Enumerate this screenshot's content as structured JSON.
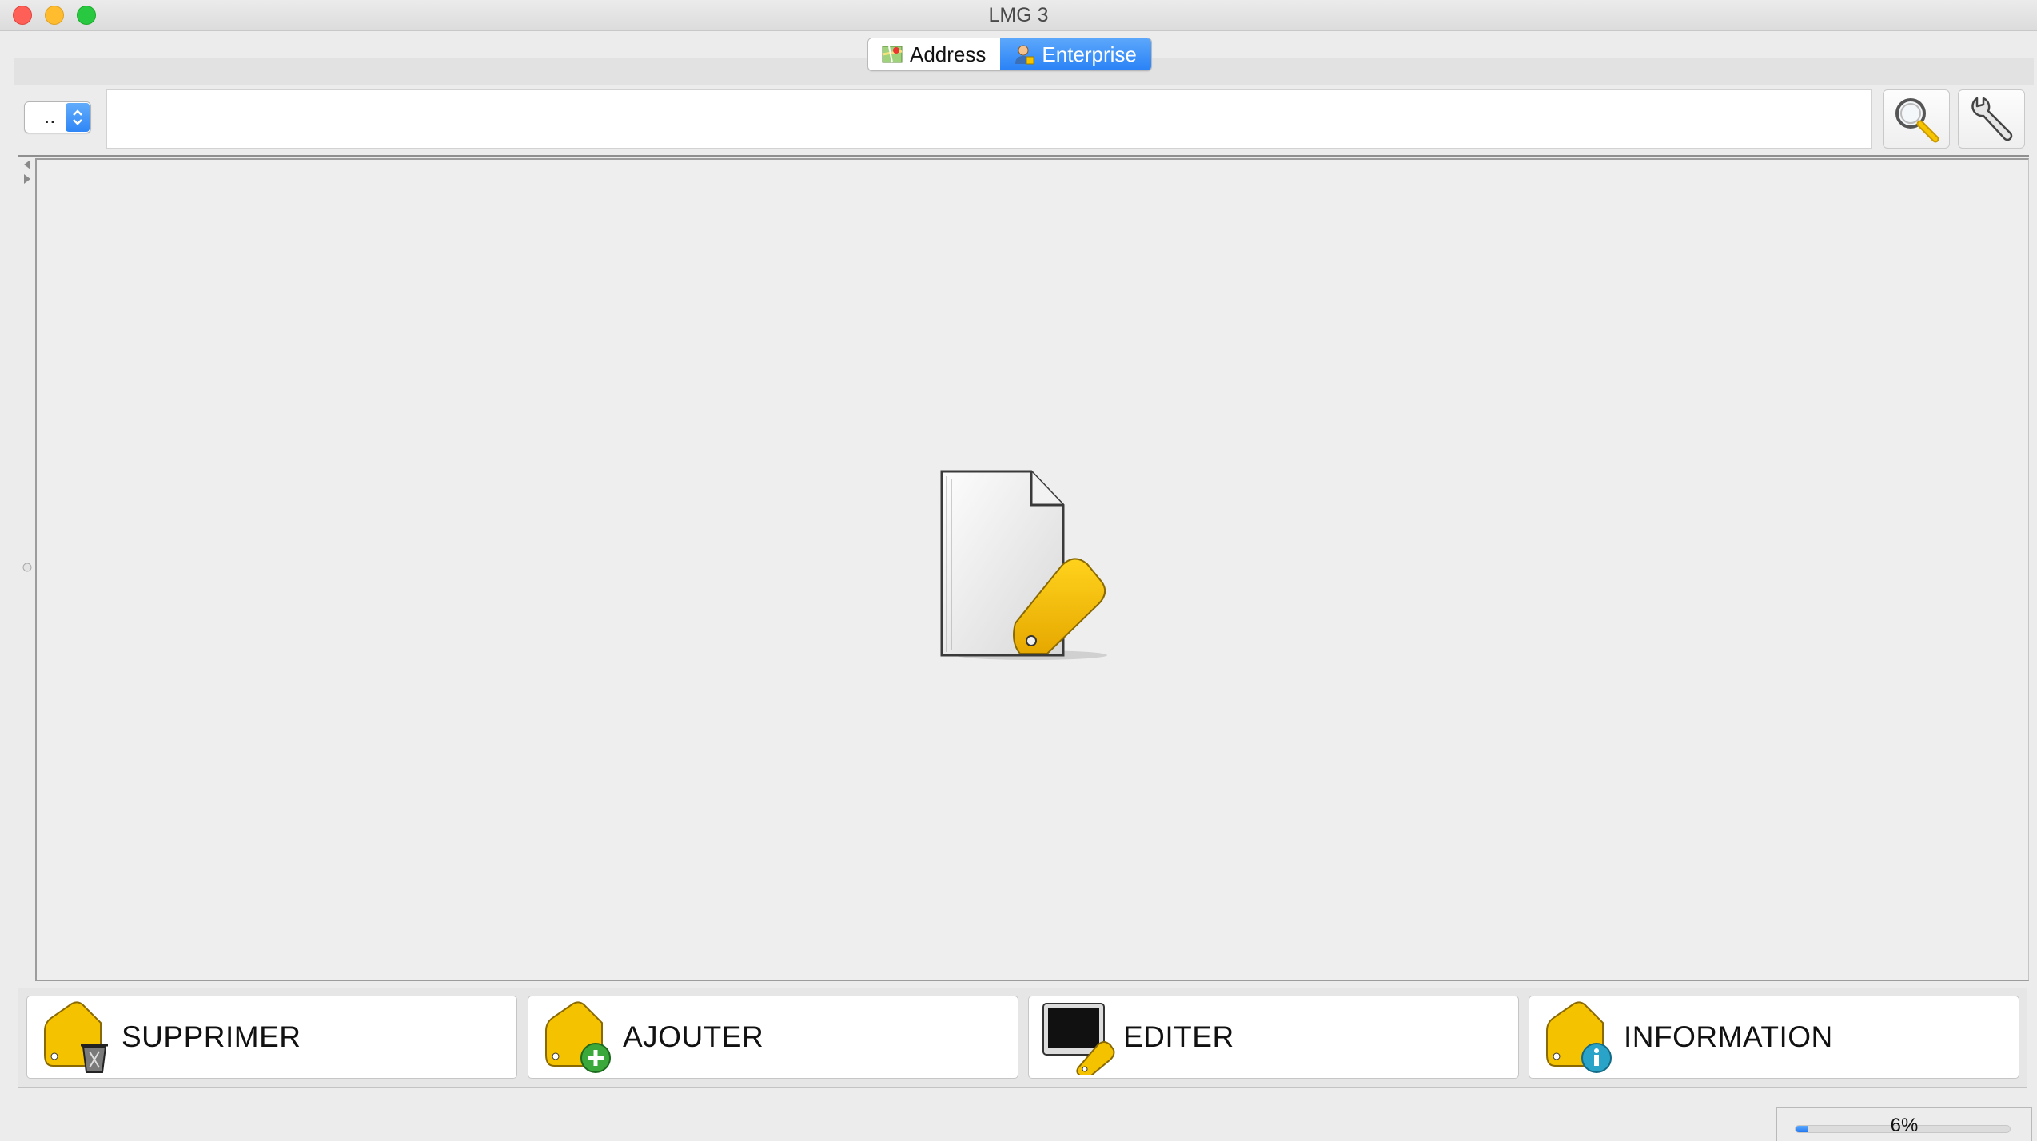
{
  "window": {
    "title": "LMG 3"
  },
  "tabs": [
    {
      "label": "Address",
      "icon": "map-icon",
      "active": false
    },
    {
      "label": "Enterprise",
      "icon": "enterprise-user-icon",
      "active": true
    }
  ],
  "search": {
    "scope_value": "..",
    "query": "",
    "search_icon": "magnifier-icon",
    "settings_icon": "wrench-icon"
  },
  "main": {
    "placeholder_icon": "document-tag-icon"
  },
  "actions": [
    {
      "label": "SUPPRIMER",
      "icon": "tag-delete-icon"
    },
    {
      "label": "AJOUTER",
      "icon": "tag-add-icon"
    },
    {
      "label": "EDITER",
      "icon": "tag-edit-icon"
    },
    {
      "label": "INFORMATION",
      "icon": "tag-info-icon"
    }
  ],
  "status": {
    "progress_fraction": 0.06,
    "progress_text": "6%"
  },
  "colors": {
    "accent": "#2a82f6",
    "tag": "#f7c400"
  }
}
